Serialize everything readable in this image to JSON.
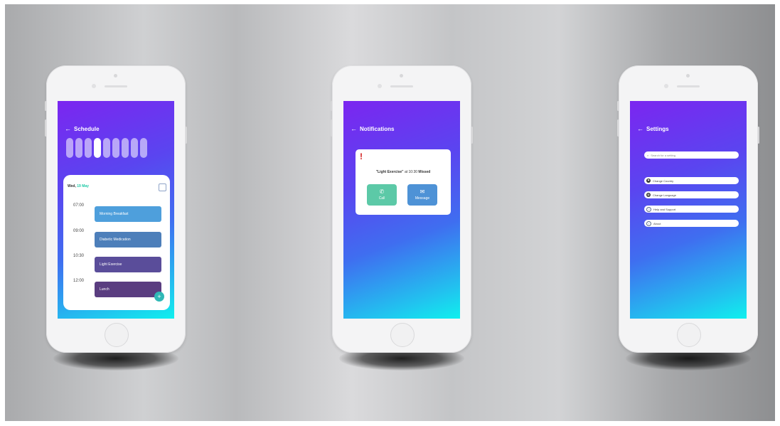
{
  "schedule": {
    "back_icon": "arrow-left-icon",
    "title": "Schedule",
    "days": [
      {
        "num": "",
        "label": ""
      },
      {
        "num": "",
        "label": ""
      },
      {
        "num": "",
        "label": ""
      },
      {
        "num": "",
        "label": "",
        "selected": true
      },
      {
        "num": "",
        "label": ""
      },
      {
        "num": "",
        "label": ""
      },
      {
        "num": "",
        "label": ""
      },
      {
        "num": "",
        "label": ""
      },
      {
        "num": "",
        "label": ""
      }
    ],
    "date_day": "Wed,",
    "date_rest": "19 May",
    "calendar_icon": "calendar-icon",
    "items": [
      {
        "time": "07:00",
        "label": "Morning Breakfast",
        "color": "#4e9fdc"
      },
      {
        "time": "09:00",
        "label": "Diabetic Medication",
        "color": "#4d7fba"
      },
      {
        "time": "10:30",
        "label": "Light Exercise",
        "color": "#5a4d9a"
      },
      {
        "time": "12:00",
        "label": "Lunch",
        "color": "#5a3d80"
      }
    ],
    "fab_label": "+"
  },
  "notifications": {
    "back_icon": "arrow-left-icon",
    "title": "Notifications",
    "alert_icon": "!",
    "msg_event": "\"Light Exercise\"",
    "msg_middle": "at 10:30",
    "msg_status": "Missed",
    "call_label": "Call",
    "call_color": "#5cc9a7",
    "message_label": "Message",
    "message_color": "#4e92d6"
  },
  "settings": {
    "back_icon": "arrow-left-icon",
    "title": "Settings",
    "search_placeholder": "Search for a setting",
    "items": [
      {
        "label": "Change Country",
        "icon": "flag-icon"
      },
      {
        "label": "Change Language",
        "icon": "globe-icon"
      },
      {
        "label": "Help and Support",
        "icon": "help-icon"
      },
      {
        "label": "About",
        "icon": "info-icon"
      }
    ]
  }
}
